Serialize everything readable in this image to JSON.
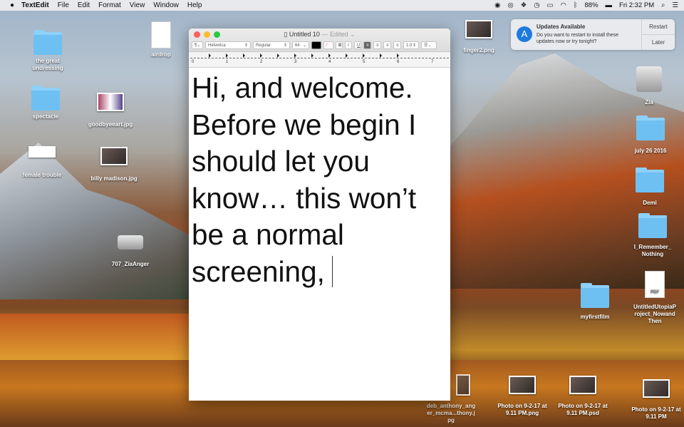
{
  "menubar": {
    "app": "TextEdit",
    "items": [
      "File",
      "Edit",
      "Format",
      "View",
      "Window",
      "Help"
    ],
    "battery": "88%",
    "clock": "Fri 2:32 PM"
  },
  "window": {
    "title": "Untitled 10",
    "status": "— Edited",
    "toolbar": {
      "paragraph": "¶",
      "font": "Helvetica",
      "style": "Regular",
      "size": "64",
      "bold": "B",
      "italic": "I",
      "underline": "U",
      "spacing": "1.0"
    },
    "ruler": [
      "0",
      "1",
      "2",
      "3",
      "4",
      "5",
      "6",
      "7"
    ],
    "text": "Hi, and welcome.\nBefore we begin I\nshould let you\nknow… this won’t\nbe a normal\nscreening,"
  },
  "notification": {
    "title": "Updates Available",
    "body": "Do you want to restart to install these updates now or try tonight?",
    "restart": "Restart",
    "later": "Later"
  },
  "desktop": {
    "icons": [
      "the great undressing",
      "spectacle",
      "female trouble",
      "goodbyeeart.jpg",
      "billy madison.jpg",
      "airdrop",
      "707_ZiaAnger",
      "finger2.png",
      "Zia",
      "july 26 2016",
      "Demi",
      "I_Remember_Nothing",
      "UntitledUtopiaProject_NowandThen",
      "myfirstfilm",
      "deb_anthony_anger_mcma...thony.jpg",
      "Photo on 9-2-17 at 9.11 PM.png",
      "Photo on 9-2-17 at 9.11 PM.psd",
      "Photo on 9-2-17 at 9.11 PM"
    ],
    "pdf_badge": "PDF"
  }
}
